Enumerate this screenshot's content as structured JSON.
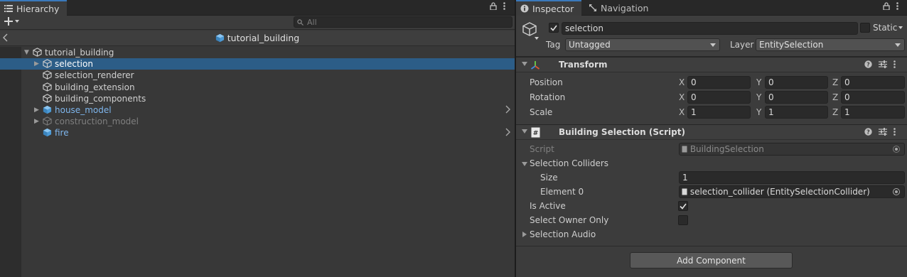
{
  "hierarchy": {
    "tab_label": "Hierarchy",
    "search_placeholder": "All",
    "scene_title": "tutorial_building",
    "items": [
      {
        "label": "tutorial_building",
        "depth": 0,
        "expanded": true,
        "kind": "object"
      },
      {
        "label": "selection",
        "depth": 1,
        "expanded": false,
        "kind": "object",
        "selected": true
      },
      {
        "label": "selection_renderer",
        "depth": 1,
        "kind": "object"
      },
      {
        "label": "building_extension",
        "depth": 1,
        "kind": "object"
      },
      {
        "label": "building_components",
        "depth": 1,
        "kind": "object"
      },
      {
        "label": "house_model",
        "depth": 1,
        "expanded": false,
        "kind": "prefab"
      },
      {
        "label": "construction_model",
        "depth": 1,
        "expanded": false,
        "kind": "disabled"
      },
      {
        "label": "fire",
        "depth": 1,
        "kind": "prefab"
      }
    ]
  },
  "inspector": {
    "tabs": [
      {
        "label": "Inspector",
        "icon": "info-icon"
      },
      {
        "label": "Navigation",
        "icon": "navigation-icon"
      }
    ],
    "object": {
      "name": "selection",
      "active": true,
      "static_label": "Static",
      "static": false,
      "tag_label": "Tag",
      "tag_value": "Untagged",
      "layer_label": "Layer",
      "layer_value": "EntitySelection"
    },
    "transform": {
      "title": "Transform",
      "rows": [
        {
          "label": "Position",
          "x": "0",
          "y": "0",
          "z": "0"
        },
        {
          "label": "Rotation",
          "x": "0",
          "y": "0",
          "z": "0"
        },
        {
          "label": "Scale",
          "x": "1",
          "y": "1",
          "z": "1"
        }
      ],
      "axis_x": "X",
      "axis_y": "Y",
      "axis_z": "Z"
    },
    "script_component": {
      "title": "Building Selection (Script)",
      "script_label": "Script",
      "script_value": "BuildingSelection",
      "colliders_label": "Selection Colliders",
      "size_label": "Size",
      "size_value": "1",
      "element0_label": "Element 0",
      "element0_value": "selection_collider (EntitySelectionCollider)",
      "is_active_label": "Is Active",
      "is_active": true,
      "owner_only_label": "Select Owner Only",
      "owner_only": false,
      "audio_label": "Selection Audio"
    },
    "add_component_label": "Add Component"
  },
  "colors": {
    "selection_highlight": "#2c5d87",
    "prefab_text": "#7eb5ec",
    "active_tab_accent": "#3a79bb"
  }
}
